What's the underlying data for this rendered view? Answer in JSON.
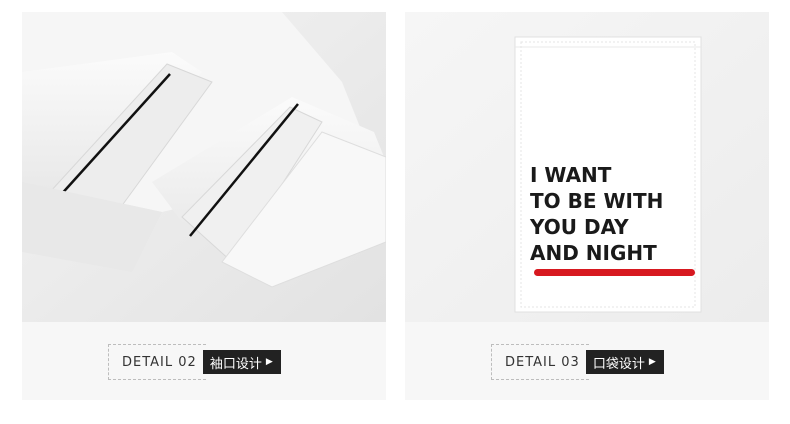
{
  "panels": [
    {
      "image": "sleeve-cuff-photo",
      "detail_label": "DETAIL  02",
      "tag_label": "袖口设计",
      "tag_arrow": "▶"
    },
    {
      "image": "pocket-photo",
      "detail_label": "DETAIL  03",
      "tag_label": "口袋设计",
      "tag_arrow": "▶",
      "pocket_text": {
        "line1": "I WANT",
        "line2": "TO BE WITH",
        "line3": "YOU DAY",
        "line4": "AND NIGHT"
      }
    }
  ],
  "colors": {
    "fabric": "#f2f2f2",
    "piping": "#111111",
    "underline": "#d71920",
    "tag_bg": "#222222"
  }
}
